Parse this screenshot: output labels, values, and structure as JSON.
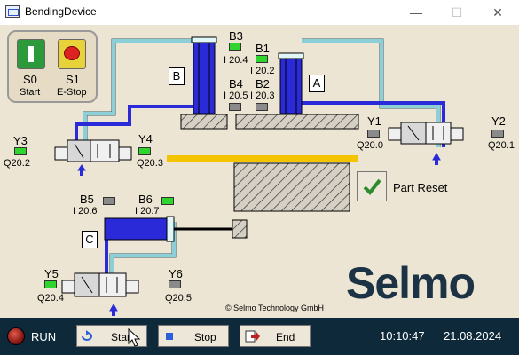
{
  "window": {
    "title": "BendingDevice",
    "minimize": "—",
    "maximize": "☐",
    "close": "✕"
  },
  "panel": {
    "s0": {
      "label": "S0",
      "caption": "Start"
    },
    "s1": {
      "label": "S1",
      "caption": "E-Stop"
    }
  },
  "cylinders": {
    "a": "A",
    "b": "B",
    "c": "C"
  },
  "sensors": {
    "b1": {
      "name": "B1",
      "addr": "I 20.2",
      "state": "on"
    },
    "b2": {
      "name": "B2",
      "addr": "I 20.3",
      "state": "off"
    },
    "b3": {
      "name": "B3",
      "addr": "I 20.4",
      "state": "on"
    },
    "b4": {
      "name": "B4",
      "addr": "I 20.5",
      "state": "off"
    },
    "b5": {
      "name": "B5",
      "addr": "I 20.6",
      "state": "off"
    },
    "b6": {
      "name": "B6",
      "addr": "I 20.7",
      "state": "on"
    }
  },
  "outputs": {
    "y1": {
      "name": "Y1",
      "addr": "Q20.0",
      "state": "off"
    },
    "y2": {
      "name": "Y2",
      "addr": "Q20.1",
      "state": "off"
    },
    "y3": {
      "name": "Y3",
      "addr": "Q20.2",
      "state": "on"
    },
    "y4": {
      "name": "Y4",
      "addr": "Q20.3",
      "state": "on"
    },
    "y5": {
      "name": "Y5",
      "addr": "Q20.4",
      "state": "on"
    },
    "y6": {
      "name": "Y6",
      "addr": "Q20.5",
      "state": "off"
    }
  },
  "part_reset_label": "Part Reset",
  "brand": "Selmo",
  "copyright": "© Selmo Technology GmbH",
  "statusbar": {
    "run_label": "RUN",
    "start_label": "Start",
    "stop_label": "Stop",
    "end_label": "End",
    "time": "10:10:47",
    "date": "21.08.2024"
  },
  "colors": {
    "cylinder_blue": "#2a2ad8",
    "air_line": "#a8e4ec",
    "strip_yellow": "#f5c400",
    "brand": "#1b3344"
  }
}
